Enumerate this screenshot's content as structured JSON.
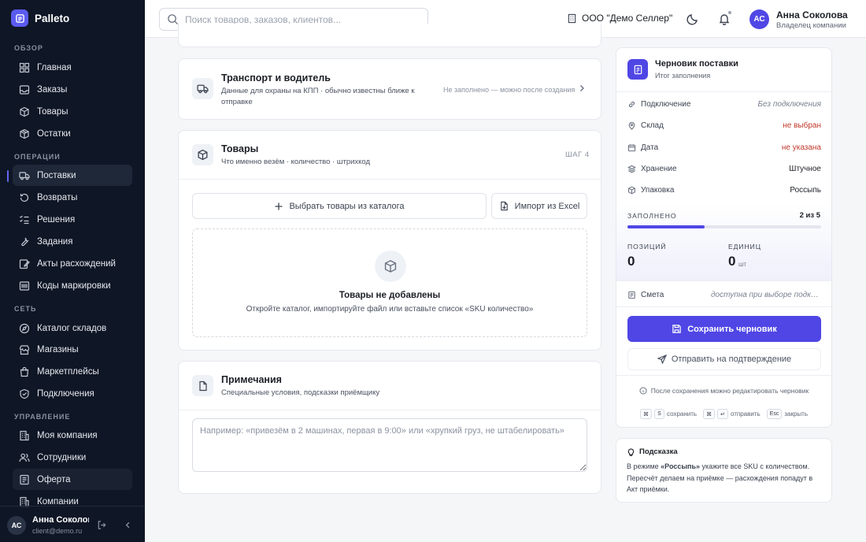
{
  "app": {
    "name": "Palleto"
  },
  "sidebar": {
    "sections": [
      {
        "title": "ОБЗОР",
        "items": [
          {
            "label": "Главная",
            "icon": "grid-icon"
          },
          {
            "label": "Заказы",
            "icon": "inbox-icon"
          },
          {
            "label": "Товары",
            "icon": "package-icon"
          },
          {
            "label": "Остатки",
            "icon": "box-icon"
          }
        ]
      },
      {
        "title": "ОПЕРАЦИИ",
        "items": [
          {
            "label": "Поставки",
            "icon": "truck-icon"
          },
          {
            "label": "Возвраты",
            "icon": "undo-icon"
          },
          {
            "label": "Решения",
            "icon": "list-check-icon"
          },
          {
            "label": "Задания",
            "icon": "wrench-icon"
          },
          {
            "label": "Акты расхождений",
            "icon": "edit-icon"
          },
          {
            "label": "Коды маркировки",
            "icon": "barcode-icon"
          }
        ]
      },
      {
        "title": "СЕТЬ",
        "items": [
          {
            "label": "Каталог складов",
            "icon": "compass-icon"
          },
          {
            "label": "Магазины",
            "icon": "store-icon"
          },
          {
            "label": "Маркетплейсы",
            "icon": "bag-icon"
          },
          {
            "label": "Подключения",
            "icon": "shield-icon"
          }
        ]
      },
      {
        "title": "УПРАВЛЕНИЕ",
        "items": [
          {
            "label": "Моя компания",
            "icon": "building-icon"
          },
          {
            "label": "Сотрудники",
            "icon": "users-icon"
          },
          {
            "label": "Оферта",
            "icon": "document-icon"
          },
          {
            "label": "Компании",
            "icon": "building-icon"
          }
        ]
      }
    ],
    "footer": {
      "initials": "АС",
      "name": "Анна Соколова",
      "email": "client@demo.ru"
    }
  },
  "header": {
    "search_placeholder": "Поиск товаров, заказов, клиентов...",
    "org": "ООО \"Демо Селлер\"",
    "user": {
      "initials": "АС",
      "name": "Анна Соколова",
      "role": "Владелец компании"
    }
  },
  "transport": {
    "title": "Транспорт и водитель",
    "subtitle": "Данные для охраны на КПП · обычно известны ближе к отправке",
    "status": "Не заполнено — можно после создания"
  },
  "goods": {
    "title": "Товары",
    "subtitle": "Что именно везём · количество · штрихкод",
    "step": "ШАГ 4",
    "catalog_button": "Выбрать товары из каталога",
    "import_button": "Импорт из Excel",
    "empty_title": "Товары не добавлены",
    "empty_text": "Откройте каталог, импортируйте файл или вставьте список «SKU количество»"
  },
  "notes": {
    "title": "Примечания",
    "subtitle": "Специальные условия, подсказки приёмщику",
    "placeholder": "Например: «привезём в 2 машинах, первая в 9:00» или «хрупкий груз, не штабелировать»"
  },
  "draft": {
    "title": "Черновик поставки",
    "subtitle": "Итог заполнения",
    "rows": [
      {
        "label": "Подключение",
        "value": "Без подключения",
        "style": "ital",
        "icon": "link-icon"
      },
      {
        "label": "Склад",
        "value": "не выбран",
        "style": "red",
        "icon": "pin-icon"
      },
      {
        "label": "Дата",
        "value": "не указана",
        "style": "red",
        "icon": "calendar-icon"
      },
      {
        "label": "Хранение",
        "value": "Штучное",
        "style": "normal",
        "icon": "layers-icon"
      },
      {
        "label": "Упаковка",
        "value": "Россыпь",
        "style": "normal",
        "icon": "package-icon"
      }
    ],
    "progress_label": "ЗАПОЛНЕНО",
    "progress_text": "2 из 5",
    "progress": 0.4,
    "positions_label": "ПОЗИЦИЙ",
    "positions_value": "0",
    "units_label": "ЕДИНИЦ",
    "units_value": "0",
    "units_suffix": "шт",
    "estimate_label": "Смета",
    "estimate_value": "доступна при выборе подключения",
    "save_button": "Сохранить черновик",
    "send_button": "Отправить на подтверждение",
    "info": "После сохранения можно редактировать черновик",
    "shortcuts": [
      {
        "keys": [
          "⌘",
          "S"
        ],
        "label": "сохранить"
      },
      {
        "keys": [
          "⌘",
          "↵"
        ],
        "label": "отправить"
      },
      {
        "keys": [
          "Esc"
        ],
        "label": "закрыть"
      }
    ],
    "accent": "#4f46e5"
  },
  "hint": {
    "title": "Подсказка",
    "text_before": "В режиме ",
    "text_bold": "«Россыпь»",
    "text_after": " укажите все SKU с количеством. Пересчёт делаем на приёмке — расхождения попадут в Акт приёмки."
  }
}
